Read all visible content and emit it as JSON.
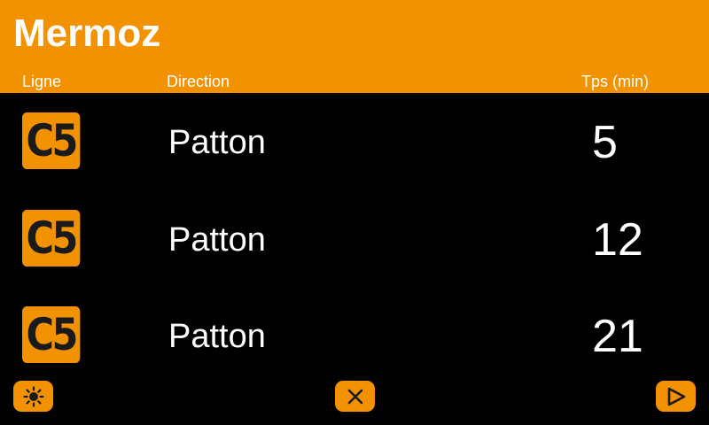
{
  "header": {
    "stop_name": "Mermoz",
    "columns": {
      "line": "Ligne",
      "direction": "Direction",
      "time": "Tps (min)"
    }
  },
  "departures": [
    {
      "line": "C5",
      "direction": "Patton",
      "minutes": "5"
    },
    {
      "line": "C5",
      "direction": "Patton",
      "minutes": "12"
    },
    {
      "line": "C5",
      "direction": "Patton",
      "minutes": "21"
    }
  ],
  "footer": {
    "buttons": [
      {
        "icon": "brightness-icon"
      },
      {
        "icon": "close-icon"
      },
      {
        "icon": "play-next-icon"
      }
    ]
  },
  "colors": {
    "accent": "#f29200",
    "background": "#000000",
    "text": "#ffffff",
    "icon": "#1a1a1a"
  }
}
